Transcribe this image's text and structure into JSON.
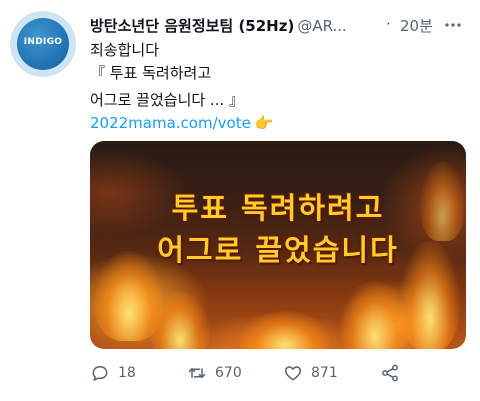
{
  "account": {
    "avatar_text": "INDIGO",
    "display_name": "방탄소년단 음원정보팀 (52Hz)",
    "handle": "@AR...",
    "separator": "·",
    "time": "20분"
  },
  "tweet": {
    "lines": [
      "죄송합니다",
      "『 투표 독려하려고",
      "어그로 끌었습니다 ... 』"
    ],
    "link": "2022mama.com/vote",
    "link_emoji": "👉",
    "link_emoji_icon": "pointing-hand-emoji"
  },
  "media": {
    "text_line1": "투표 독려하려고",
    "text_line2": "어그로 끌었습니다",
    "text_color": "#ffcc2e",
    "background": "fire"
  },
  "actions": {
    "reply_count": "18",
    "retweet_count": "670",
    "like_count": "871",
    "reply_icon": "reply-icon",
    "retweet_icon": "retweet-icon",
    "like_icon": "heart-icon",
    "share_icon": "share-icon"
  },
  "colors": {
    "link": "#1d9bf0",
    "muted": "#536471",
    "text": "#0f1419"
  }
}
